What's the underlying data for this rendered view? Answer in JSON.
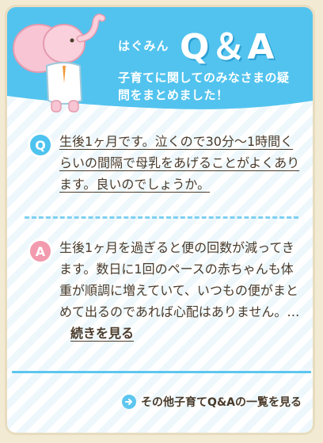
{
  "header": {
    "brand": "はぐみん",
    "title": "Q＆A",
    "subtitle": "子育てに関してのみなさまの疑問をまとめました！"
  },
  "qa": {
    "question_badge": "Q",
    "question": "生後1ヶ月です。泣くので30分〜1時間くらいの間隔で母乳をあげることがよくあります。良いのでしょうか。",
    "answer_badge": "A",
    "answer": "生後1ヶ月を過ぎると便の回数が減ってきます。数日に1回のペースの赤ちゃんも体重が順調に増えていて、いつもの便がまとめて出るのであれば心配はありません。…",
    "more_label": "続きを見る"
  },
  "footer": {
    "list_link_label": "その他子育てQ&Aの一覧を見る"
  },
  "colors": {
    "accent_blue": "#4ec3ef",
    "accent_pink": "#f29aae",
    "text": "#4a3a2a",
    "frame": "#e8dcbf"
  },
  "icons": {
    "mascot": "elephant-mascot",
    "arrow": "arrow-right-circle-icon"
  }
}
